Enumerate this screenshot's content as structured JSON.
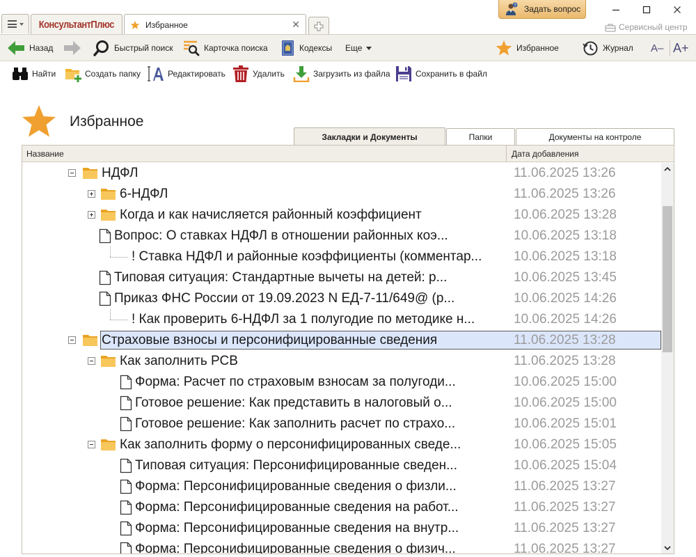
{
  "window": {
    "brand": "КонсультантПлюс",
    "active_tab": "Избранное",
    "ask_button": "Задать вопрос",
    "service_center": "Сервисный центр",
    "minimize": "—",
    "maximize": "☐",
    "close": "✕"
  },
  "toolbar": {
    "back": "Назад",
    "quick_search": "Быстрый поиск",
    "search_card": "Карточка поиска",
    "codes": "Кодексы",
    "more": "Еще",
    "favorites": "Избранное",
    "journal": "Журнал",
    "font_smaller": "A–",
    "font_larger": "A+"
  },
  "toolbar2": {
    "find": "Найти",
    "create_folder": "Создать папку",
    "edit": "Редактировать",
    "delete": "Удалить",
    "load_from_file": "Загрузить из файла",
    "save_to_file": "Сохранить в файл"
  },
  "page_title": "Избранное",
  "tabs": [
    {
      "label": "Закладки и Документы",
      "active": true
    },
    {
      "label": "Папки",
      "active": false
    },
    {
      "label": "Документы на контроле",
      "active": false
    }
  ],
  "columns": {
    "name": "Название",
    "date": "Дата добавления"
  },
  "rows": [
    {
      "type": "folder",
      "level": 0,
      "expander": "minus",
      "title": "НДФЛ",
      "date": "11.06.2025 13:26"
    },
    {
      "type": "folder",
      "level": 1,
      "expander": "plus",
      "title": "6-НДФЛ",
      "date": "11.06.2025 13:26"
    },
    {
      "type": "folder",
      "level": 1,
      "expander": "plus",
      "title": "Когда и как начисляется районный коэффициент",
      "date": "10.06.2025 13:28"
    },
    {
      "type": "doc",
      "level": 1,
      "title": "Вопрос: О ставках НДФЛ в отношении районных коэ...",
      "date": "10.06.2025 13:18"
    },
    {
      "type": "bookmark",
      "level": 2,
      "title": "! Ставка НДФЛ и районные коэффициенты (комментар...",
      "date": "10.06.2025 13:18"
    },
    {
      "type": "doc",
      "level": 1,
      "title": "Типовая ситуация: Стандартные вычеты на детей: р...",
      "date": "10.06.2025 13:45"
    },
    {
      "type": "doc",
      "level": 1,
      "title": "Приказ ФНС России от 19.09.2023 N ЕД-7-11/649@ (р...",
      "date": "10.06.2025 14:26"
    },
    {
      "type": "bookmark",
      "level": 2,
      "title": "! Как проверить 6-НДФЛ за 1 полугодие по методике н...",
      "date": "10.06.2025 14:26"
    },
    {
      "type": "folder",
      "level": 0,
      "expander": "minus",
      "title": "Страховые взносы и персонифицированные сведения",
      "date": "11.06.2025 13:28",
      "selected": true
    },
    {
      "type": "folder",
      "level": 1,
      "expander": "minus",
      "title": "Как заполнить РСВ",
      "date": "11.06.2025 13:28"
    },
    {
      "type": "doc",
      "level": 2,
      "title": "Форма: Расчет по страховым взносам за полугоди...",
      "date": "10.06.2025 15:00"
    },
    {
      "type": "doc",
      "level": 2,
      "title": "Готовое решение: Как представить в налоговый о...",
      "date": "10.06.2025 15:00"
    },
    {
      "type": "doc",
      "level": 2,
      "title": "Готовое решение: Как заполнить расчет по страхо...",
      "date": "10.06.2025 15:01"
    },
    {
      "type": "folder",
      "level": 1,
      "expander": "minus",
      "title": "Как заполнить форму о персонифицированных сведе...",
      "date": "10.06.2025 15:05"
    },
    {
      "type": "doc",
      "level": 2,
      "title": "Типовая ситуация: Персонифицированные сведен...",
      "date": "10.06.2025 15:04"
    },
    {
      "type": "doc",
      "level": 2,
      "title": "Форма: Персонифицированные сведения о физли...",
      "date": "11.06.2025 13:27"
    },
    {
      "type": "doc",
      "level": 2,
      "title": "Форма: Персонифицированные сведения на работ...",
      "date": "11.06.2025 13:27"
    },
    {
      "type": "doc",
      "level": 2,
      "title": "Форма: Персонифицированные сведения на внутр...",
      "date": "11.06.2025 13:27"
    },
    {
      "type": "doc",
      "level": 2,
      "title": "Форма: Персонифицированные сведения о физич...",
      "date": "11.06.2025 13:27"
    }
  ],
  "colors": {
    "brand_red": "#a3352d",
    "accent_star": "#f0a030",
    "selection_bg": "#dbe6fb",
    "date_gray": "#9b9b9b"
  },
  "icons": {
    "star": "star-icon",
    "folder": "folder-icon",
    "doc": "document-icon"
  }
}
